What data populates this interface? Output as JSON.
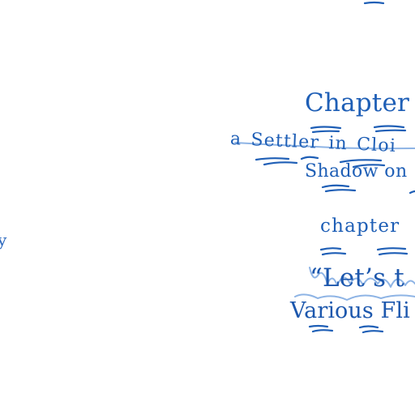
{
  "document": {
    "chapter_heading": "Chapter I",
    "subtitle_line_1": "a Settler in Cloi",
    "subtitle_line_2": "Shadow on",
    "chapter_label": "chapter",
    "quote_line": "“Let’s t",
    "various_line": "Various Fli",
    "margin_mark": "y"
  },
  "colors": {
    "ink": "#1f5fb6",
    "ink_light": "#7aa7e0",
    "background": "#ffffff"
  }
}
